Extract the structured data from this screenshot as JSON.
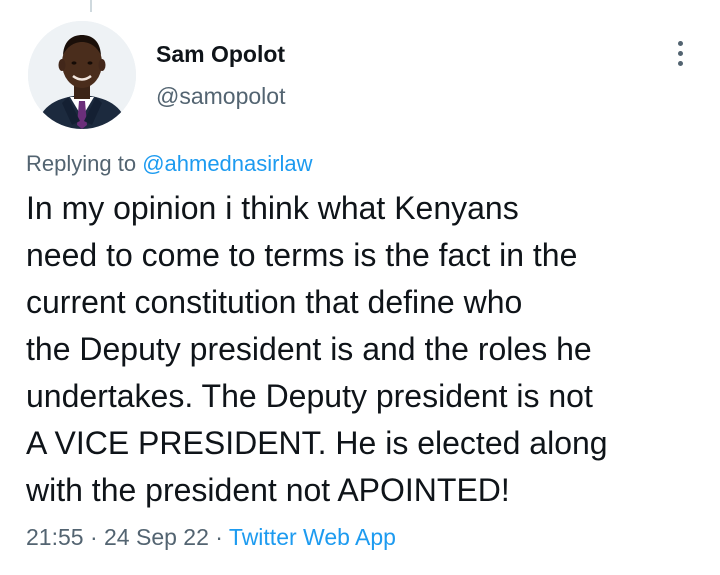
{
  "author": {
    "display_name": "Sam Opolot",
    "handle": "@samopolot",
    "avatar_icon": "profile-photo"
  },
  "more_icon": "more-vertical-icon",
  "reply": {
    "prefix": "Replying to ",
    "mention": "@ahmednasirlaw"
  },
  "tweet": {
    "lines": [
      "In my opinion i think what Kenyans",
      "need to come to terms is the fact in the",
      "current constitution that define who",
      "the Deputy president is and the roles he",
      "undertakes. The Deputy president is not",
      "A VICE PRESIDENT. He is elected along",
      "with the president not APOINTED!"
    ]
  },
  "meta": {
    "time": "21:55",
    "separator": " · ",
    "date": "24 Sep 22",
    "source": "Twitter Web App"
  },
  "colors": {
    "text": "#0f1419",
    "secondary": "#536471",
    "link": "#1d9bf0"
  }
}
